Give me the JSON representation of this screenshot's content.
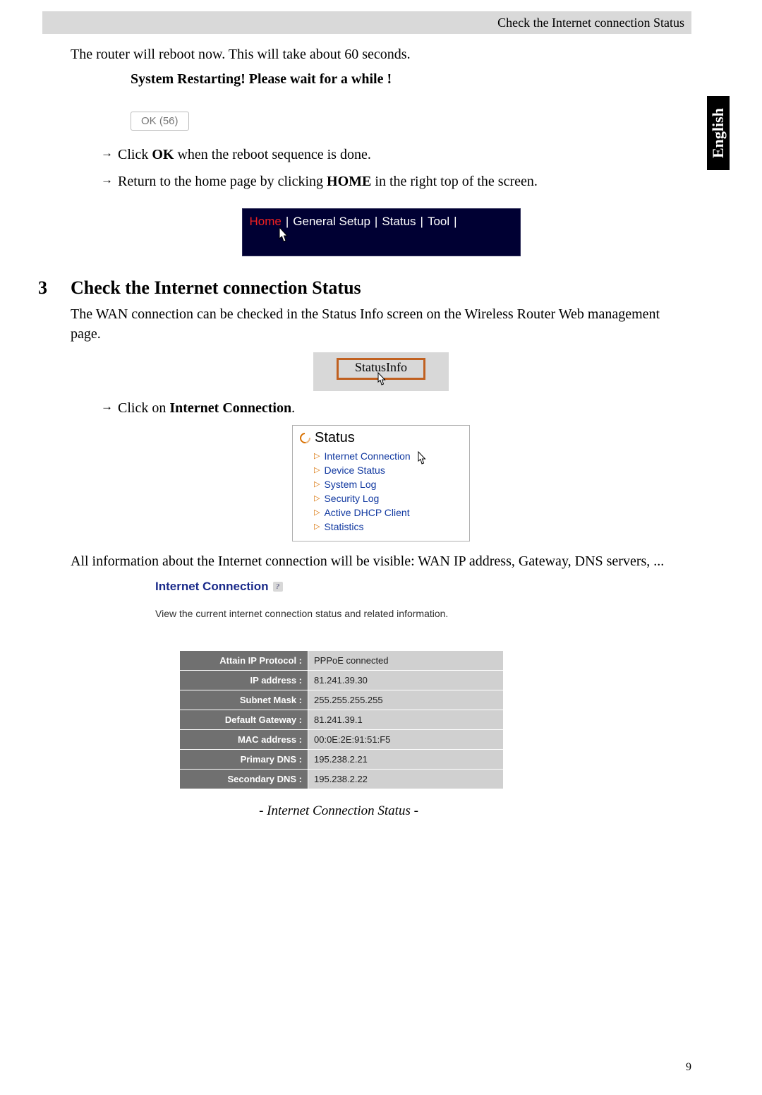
{
  "header": {
    "breadcrumb": "Check the Internet connection Status"
  },
  "language_tab": "English",
  "intro_text": "The router will reboot now. This will take about 60 seconds.",
  "restart": {
    "message": "System Restarting! Please wait for a while !",
    "ok_label": "OK (56)"
  },
  "steps_top": [
    {
      "pre": "Click ",
      "bold": "OK",
      "post": " when the reboot sequence is done."
    },
    {
      "pre": "Return to the home page by clicking ",
      "bold": "HOME",
      "post": " in the right top of the screen."
    }
  ],
  "nav": {
    "items": [
      "Home",
      "General Setup",
      "Status",
      "Tool"
    ],
    "active_index": 0
  },
  "section": {
    "number": "3",
    "title": "Check the Internet connection Status",
    "body": "The WAN connection can be checked in the Status Info screen on the Wireless Router Web management page."
  },
  "statusinfo": {
    "button_label": "StatusInfo"
  },
  "steps_mid": [
    {
      "pre": "Click on ",
      "bold": "Internet Connection",
      "post": "."
    }
  ],
  "status_menu": {
    "title": "Status",
    "items": [
      "Internet Connection",
      "Device Status",
      "System Log",
      "Security Log",
      "Active DHCP Client",
      "Statistics"
    ]
  },
  "info_text": "All information about the Internet connection will be visible: WAN IP address, Gateway, DNS servers, ...",
  "ic": {
    "title": "Internet Connection",
    "desc": "View the current internet connection status and related information.",
    "rows": [
      {
        "label": "Attain IP Protocol :",
        "value": "PPPoE connected"
      },
      {
        "label": "IP address :",
        "value": "81.241.39.30"
      },
      {
        "label": "Subnet Mask :",
        "value": "255.255.255.255"
      },
      {
        "label": "Default Gateway :",
        "value": "81.241.39.1"
      },
      {
        "label": "MAC address :",
        "value": "00:0E:2E:91:51:F5"
      },
      {
        "label": "Primary DNS :",
        "value": "195.238.2.21"
      },
      {
        "label": "Secondary DNS :",
        "value": "195.238.2.22"
      }
    ],
    "caption": "- Internet Connection Status -"
  },
  "page_number": "9"
}
